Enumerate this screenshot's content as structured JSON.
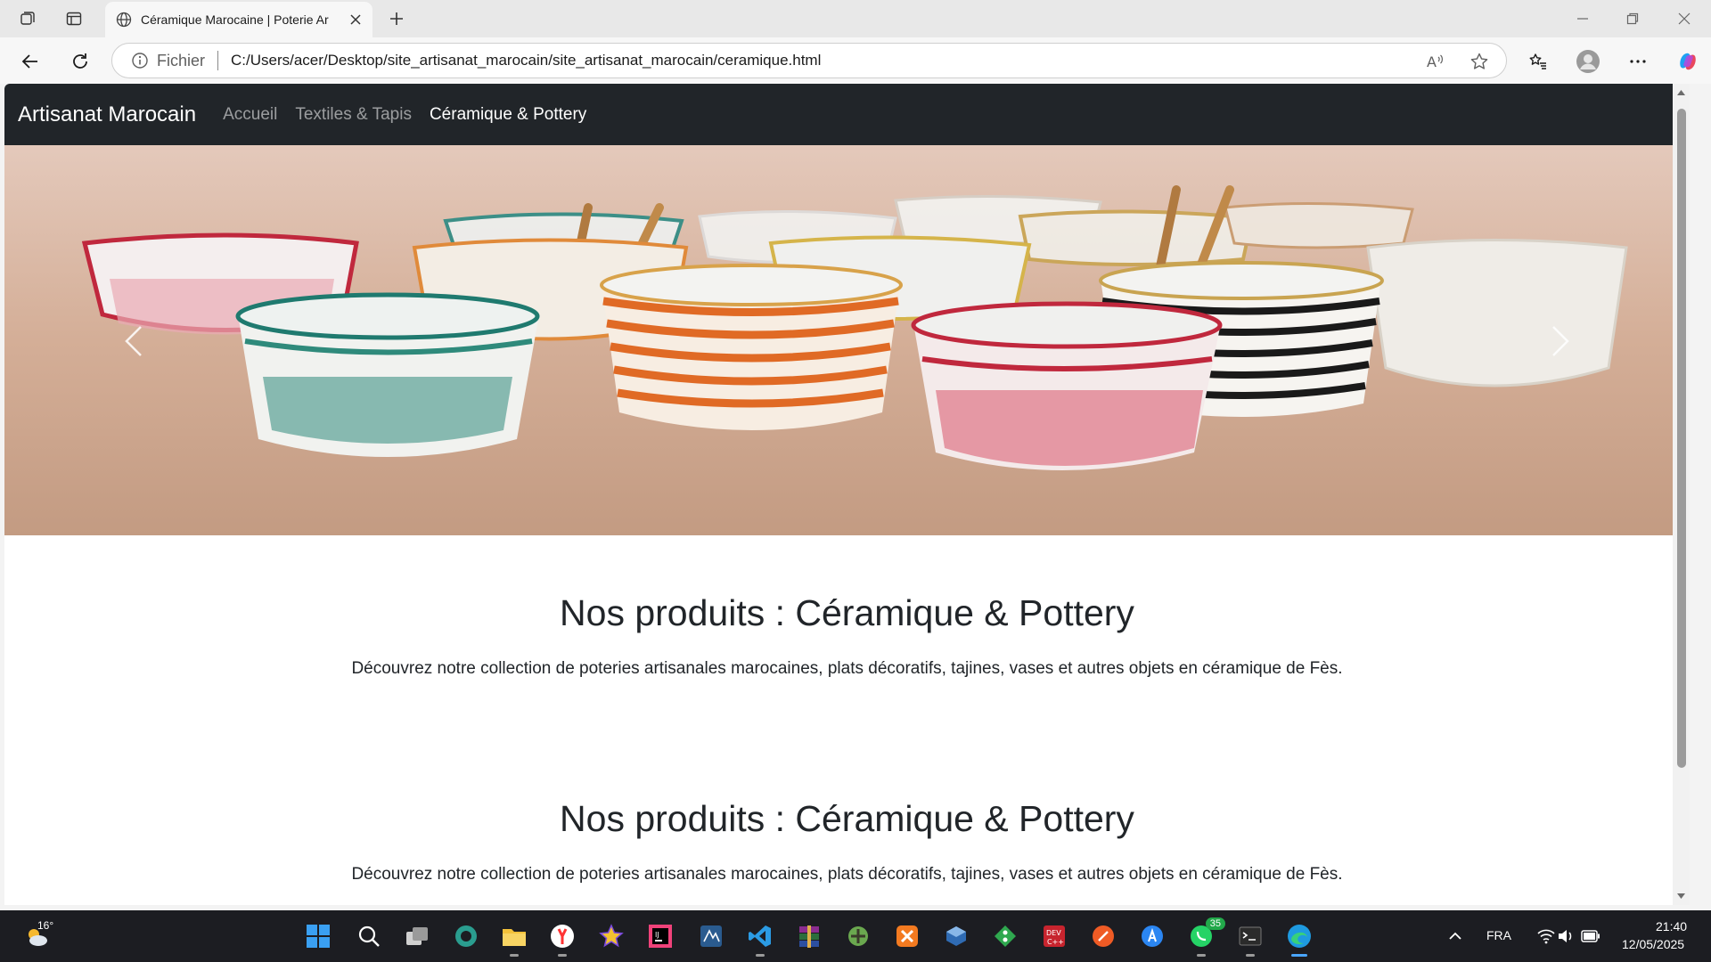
{
  "browser": {
    "tab_title": "Céramique Marocaine | Poterie Ar",
    "address_scheme": "Fichier",
    "address_url": "C:/Users/acer/Desktop/site_artisanat_marocain/site_artisanat_marocain/ceramique.html"
  },
  "navbar": {
    "brand": "Artisanat Marocain",
    "links": [
      {
        "label": "Accueil",
        "active": false
      },
      {
        "label": "Textiles & Tapis",
        "active": false
      },
      {
        "label": "Céramique & Pottery",
        "active": true
      }
    ]
  },
  "sections": [
    {
      "heading": "Nos produits : Céramique & Pottery",
      "text": "Découvrez notre collection de poteries artisanales marocaines, plats décoratifs, tajines, vases et autres objets en céramique de Fès."
    },
    {
      "heading": "Nos produits : Céramique & Pottery",
      "text": "Découvrez notre collection de poteries artisanales marocaines, plats décoratifs, tajines, vases et autres objets en céramique de Fès."
    }
  ],
  "taskbar": {
    "weather_temp": "16°",
    "whatsapp_badge": "35",
    "language": "FRA",
    "time": "21:40",
    "date": "12/05/2025",
    "apps": [
      "start-icon",
      "search-icon",
      "task-view-icon",
      "edge-dev-icon",
      "file-explorer-icon",
      "yandex-browser-icon",
      "star-app-icon",
      "intellij-icon",
      "sql-developer-icon",
      "vscode-icon",
      "winrar-icon",
      "green-app-icon",
      "xampp-icon",
      "virtualbox-icon",
      "git-icon",
      "devcpp-icon",
      "postman-icon",
      "app-store-icon",
      "whatsapp-icon",
      "terminal-icon",
      "edge-icon"
    ]
  },
  "colors": {
    "navbar_bg": "#212529",
    "taskbar_bg": "#1c1d22",
    "accent": "#0a84ff"
  }
}
